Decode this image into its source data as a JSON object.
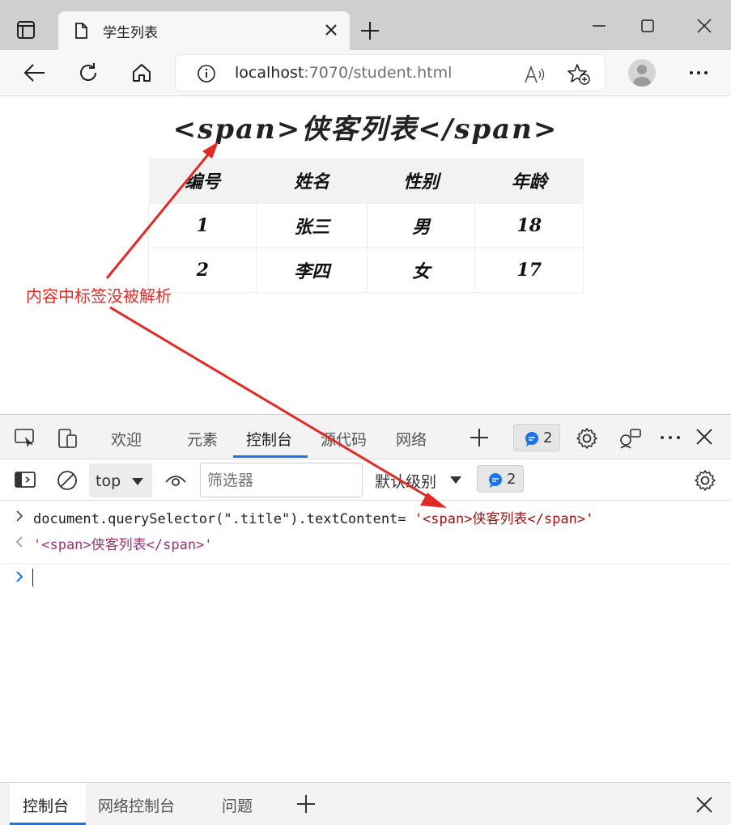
{
  "browser": {
    "tab_title": "学生列表",
    "url_host": "localhost",
    "url_rest": ":7070/student.html"
  },
  "page": {
    "title": "<span>侠客列表</span>",
    "table": {
      "headers": [
        "编号",
        "姓名",
        "性别",
        "年龄"
      ],
      "rows": [
        [
          "1",
          "张三",
          "男",
          "18"
        ],
        [
          "2",
          "李四",
          "女",
          "17"
        ]
      ]
    },
    "annotation": "内容中标签没被解析",
    "annotation_color": "#e02a26"
  },
  "devtools": {
    "tabs": [
      "欢迎",
      "元素",
      "控制台",
      "源代码",
      "网络"
    ],
    "active_tab": "控制台",
    "issues_count": "2",
    "console_toolbar": {
      "context": "top",
      "filter_placeholder": "筛选器",
      "levels_label": "默认级别",
      "issues_count": "2"
    },
    "console": {
      "input_code": "document.querySelector(\".title\").textContent= ",
      "input_string": "'<span>侠客列表</span>'",
      "result": "'<span>侠客列表</span>'"
    },
    "drawer_tabs": [
      "控制台",
      "网络控制台",
      "问题"
    ],
    "accent_color": "#1a73e8"
  }
}
